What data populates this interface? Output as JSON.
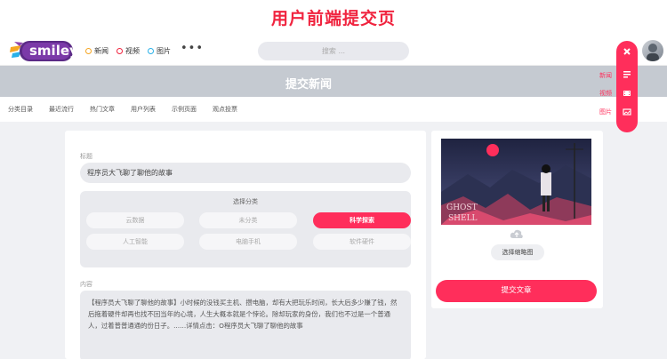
{
  "page_title": "用户前端提交页",
  "topbar": {
    "logo_text": "smiley",
    "nav": [
      {
        "label": "新闻",
        "color": "#f5a623"
      },
      {
        "label": "视频",
        "color": "#f0243f"
      },
      {
        "label": "图片",
        "color": "#2ab1e8"
      }
    ],
    "more_label": "•••",
    "search_placeholder": "搜索 ..."
  },
  "hero": {
    "title": "提交新闻"
  },
  "subnav": [
    "分类目录",
    "最近流行",
    "热门文章",
    "用户列表",
    "示例页面",
    "观点投票"
  ],
  "form": {
    "title_label": "标题",
    "title_value": "程序员大飞聊了聊他的故事",
    "category_heading": "选择分类",
    "categories": [
      {
        "label": "云数据",
        "active": false
      },
      {
        "label": "未分类",
        "active": false
      },
      {
        "label": "科学探索",
        "active": true
      },
      {
        "label": "人工智能",
        "active": false
      },
      {
        "label": "电脑手机",
        "active": false
      },
      {
        "label": "软件硬件",
        "active": false
      }
    ],
    "content_label": "内容",
    "content_value": "【程序员大飞聊了聊他的故事】小时候的没钱买主机、攒电脑，却有大把玩乐时间，长大后多少赚了钱，然后拖着硬件却再也找不回当年的心境，人生大概本就是个悖论。除却玩家的身份，我们也不过是一个普通人，过着普普通通的份日子。......详情点击：O程序员大飞聊了聊他的故事"
  },
  "sidebar": {
    "choose_thumb_label": "选择缩略图",
    "submit_label": "提交文章"
  },
  "float_menu": {
    "items": [
      {
        "label": "新闻",
        "icon": "document-icon"
      },
      {
        "label": "视频",
        "icon": "video-icon"
      },
      {
        "label": "图片",
        "icon": "image-icon"
      }
    ],
    "close_icon": "close-icon"
  },
  "colors": {
    "accent": "#ff2e5b",
    "title_red": "#f0243f",
    "hero_bg": "#c5cad1"
  }
}
